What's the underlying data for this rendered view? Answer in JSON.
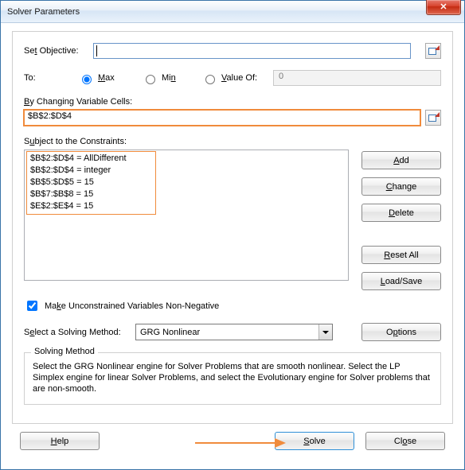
{
  "window": {
    "title": "Solver Parameters"
  },
  "objective": {
    "set_label_pre": "Se",
    "set_label_u": "t",
    "set_label_post": " Objective:",
    "value": ""
  },
  "to": {
    "label": "To:",
    "max_u": "M",
    "max_rest": "ax",
    "min_pre": "Mi",
    "min_u": "n",
    "valueof_u": "V",
    "valueof_rest": "alue Of:",
    "value_of_input": "0",
    "selected": "max"
  },
  "changing": {
    "label_u": "B",
    "label_rest": "y Changing Variable Cells:",
    "value": "$B$2:$D$4"
  },
  "constraints": {
    "label_pre": "S",
    "label_u": "u",
    "label_post": "bject to the Constraints:",
    "items": [
      "$B$2:$D$4 = AllDifferent",
      "$B$2:$D$4 = integer",
      "$B$5:$D$5 = 15",
      "$B$7:$B$8 = 15",
      "$E$2:$E$4 = 15"
    ]
  },
  "buttons": {
    "add_u": "A",
    "add_rest": "dd",
    "change_u": "C",
    "change_rest": "hange",
    "delete_u": "D",
    "delete_rest": "elete",
    "resetall_u": "R",
    "resetall_rest": "eset All",
    "loadsave_u": "L",
    "loadsave_rest": "oad/Save",
    "options_pre": "O",
    "options_u": "p",
    "options_post": "tions",
    "help_u": "H",
    "help_rest": "elp",
    "solve_u": "S",
    "solve_rest": "olve",
    "close_pre": "Cl",
    "close_u": "o",
    "close_post": "se"
  },
  "nonneg": {
    "pre": "Ma",
    "u": "k",
    "post": "e Unconstrained Variables Non-Negative",
    "checked": true
  },
  "method": {
    "label_pre": "S",
    "label_u": "e",
    "label_post": "lect a Solving Method:",
    "selected": "GRG Nonlinear"
  },
  "solving_method": {
    "title": "Solving Method",
    "desc": "Select the GRG Nonlinear engine for Solver Problems that are smooth nonlinear. Select the LP Simplex engine for linear Solver Problems, and select the Evolutionary engine for Solver problems that are non-smooth."
  }
}
